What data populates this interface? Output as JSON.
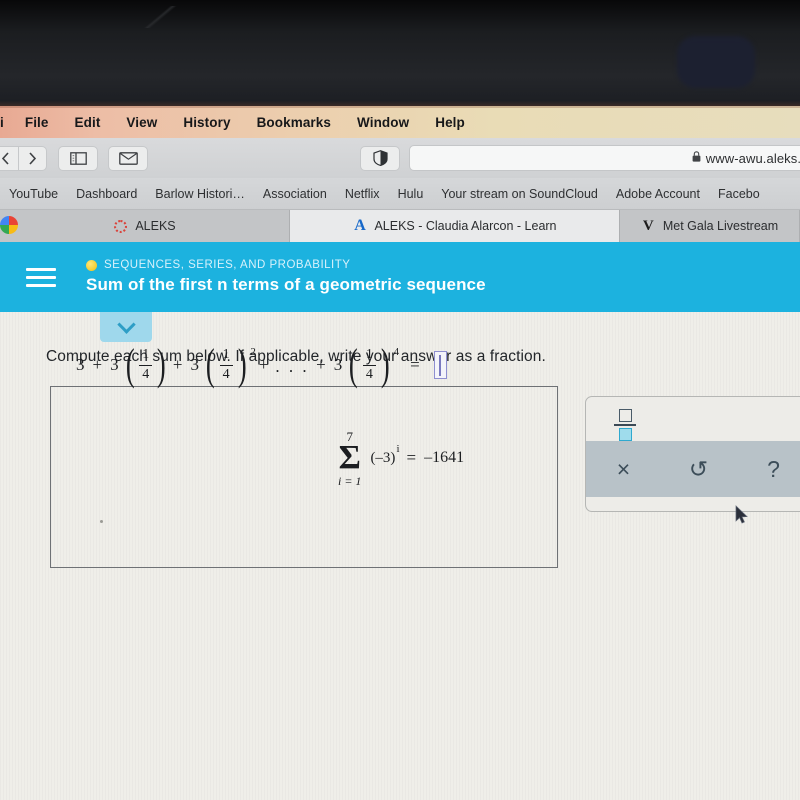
{
  "menubar": {
    "items": [
      {
        "label": "i",
        "name": "app-menu"
      },
      {
        "label": "File",
        "name": "file"
      },
      {
        "label": "Edit",
        "name": "edit"
      },
      {
        "label": "View",
        "name": "view"
      },
      {
        "label": "History",
        "name": "history"
      },
      {
        "label": "Bookmarks",
        "name": "bookmarks"
      },
      {
        "label": "Window",
        "name": "window"
      },
      {
        "label": "Help",
        "name": "help"
      }
    ]
  },
  "toolbar": {
    "back_icon": "chevron-left-icon",
    "forward_icon": "chevron-right-icon",
    "sidebar_icon": "sidebar-icon",
    "mail_icon": "envelope-icon",
    "reader_icon": "reader-contrast-icon",
    "url": "www-awu.aleks.co",
    "lock_glyph": "🔒"
  },
  "bookmarks": {
    "items": [
      "YouTube",
      "Dashboard",
      "Barlow Histori…",
      "Association",
      "Netflix",
      "Hulu",
      "Your stream on SoundCloud",
      "Adobe Account",
      "Facebo"
    ]
  },
  "tabs": [
    {
      "title": "ALEKS",
      "favicon": "aleks-ring-icon",
      "active": false
    },
    {
      "title": "ALEKS - Claudia Alarcon - Learn",
      "favicon": "aleks-a-icon",
      "active": true
    },
    {
      "title": "Met Gala Livestream",
      "favicon": "vogue-v-icon",
      "active": false
    }
  ],
  "aleks": {
    "header": {
      "category": "SEQUENCES, SERIES, AND PROBABILITY",
      "title": "Sum of the first n terms of a geometric sequence",
      "accent_color": "#1cb2df",
      "dot_color": "#f4cc2e"
    },
    "instruction": "Compute each sum below. If applicable, write your answer as a fraction.",
    "equation1": {
      "term1": "3",
      "plus": "+",
      "coef": "3",
      "fraction_num": "1",
      "fraction_den": "4",
      "exp2": "2",
      "ellipsis": ". . .",
      "exp4": "4",
      "equals": "=",
      "answer_value": ""
    },
    "equation2": {
      "upper_limit": "7",
      "sigma": "Σ",
      "lower_limit": "i = 1",
      "base": "(–3)",
      "exponent": "i",
      "equals": "=",
      "result": "–1641"
    }
  },
  "palette": {
    "fraction_button": "fraction-template",
    "clear_label": "×",
    "undo_label": "↺",
    "help_label": "?"
  }
}
